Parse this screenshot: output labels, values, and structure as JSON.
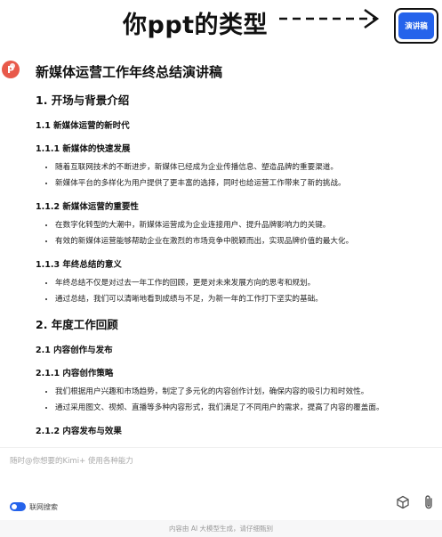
{
  "annotation": {
    "text": "你ppt的类型"
  },
  "mode_button": {
    "label": "演讲稿"
  },
  "document": {
    "title": "新媒体运营工作年终总结演讲稿",
    "sections": [
      {
        "heading": "1. 开场与背景介绍"
      },
      {
        "heading": "1.1 新媒体运营的新时代"
      },
      {
        "heading": "1.1.1 新媒体的快速发展",
        "bullets": [
          "随着互联网技术的不断进步，新媒体已经成为企业传播信息、塑造品牌的重要渠道。",
          "新媒体平台的多样化为用户提供了更丰富的选择，同时也给运营工作带来了新的挑战。"
        ]
      },
      {
        "heading": "1.1.2 新媒体运营的重要性",
        "bullets": [
          "在数字化转型的大潮中，新媒体运营成为企业连接用户、提升品牌影响力的关键。",
          "有效的新媒体运营能够帮助企业在激烈的市场竞争中脱颖而出，实现品牌价值的最大化。"
        ]
      },
      {
        "heading": "1.1.3 年终总结的意义",
        "bullets": [
          "年终总结不仅是对过去一年工作的回顾，更是对未来发展方向的思考和规划。",
          "通过总结，我们可以清晰地看到成绩与不足，为新一年的工作打下坚实的基础。"
        ]
      },
      {
        "heading": "2. 年度工作回顾"
      },
      {
        "heading": "2.1 内容创作与发布"
      },
      {
        "heading": "2.1.1 内容创作策略",
        "bullets": [
          "我们根据用户兴趣和市场趋势，制定了多元化的内容创作计划，确保内容的吸引力和时效性。",
          "通过采用图文、视频、直播等多种内容形式，我们满足了不同用户的需求，提高了内容的覆盖面。"
        ]
      },
      {
        "heading": "2.1.2 内容发布与效果"
      }
    ]
  },
  "input": {
    "placeholder": "随时@你想要的Kimi+ 使用各种能力"
  },
  "toggle": {
    "label": "联网搜索",
    "on": true
  },
  "icons": {
    "cube": "cube-icon",
    "attach": "paperclip-icon",
    "ppt": "ppt-file-icon"
  },
  "footer": {
    "note": "内容由 AI 大模型生成，请仔细甄别"
  },
  "colors": {
    "accent": "#2563eb",
    "ppt": "#e8594a"
  }
}
